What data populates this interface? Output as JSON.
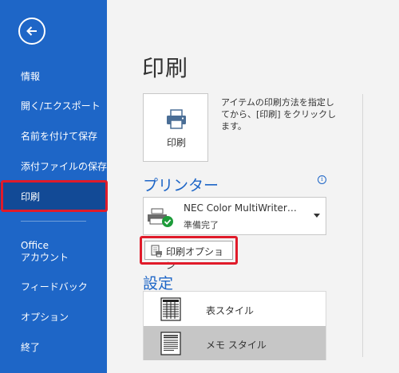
{
  "sidebar": {
    "items": [
      {
        "label": "情報"
      },
      {
        "label": "開く/エクスポート"
      },
      {
        "label": "名前を付けて保存"
      },
      {
        "label": "添付ファイルの保存"
      },
      {
        "label": "印刷"
      },
      {
        "label": "Office"
      },
      {
        "label": "アカウント"
      },
      {
        "label": "フィードバック"
      },
      {
        "label": "オプション"
      },
      {
        "label": "終了"
      }
    ]
  },
  "main": {
    "title": "印刷",
    "print_button": {
      "label": "印刷",
      "description": "アイテムの印刷方法を指定してから、[印刷] をクリックします。"
    },
    "printer_section": {
      "title": "プリンター",
      "printer_name": "NEC Color MultiWriter…",
      "printer_status": "準備完了",
      "options_button": "印刷オプション"
    },
    "settings_section": {
      "title": "設定",
      "styles": [
        {
          "label": "表スタイル",
          "selected": false
        },
        {
          "label": "メモ スタイル",
          "selected": true
        }
      ]
    }
  },
  "colors": {
    "accent": "#1e66c7",
    "active_nav": "#124a96",
    "highlight": "#e01b2a",
    "selected_style": "#c6c6c6"
  }
}
